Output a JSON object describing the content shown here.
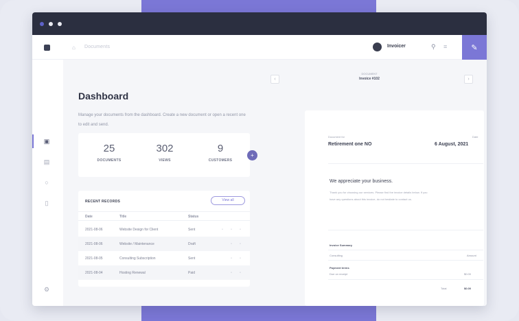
{
  "app": {
    "breadcrumb": "Documents",
    "user_name": "Invoicer",
    "colors": {
      "accent": "#7b77d6",
      "titlebar": "#2b2f40",
      "text": "#2f3345"
    }
  },
  "page": {
    "title": "Dashboard",
    "description": "Manage your documents from the dashboard. Create a new document or open a recent one to edit and send."
  },
  "stats": [
    {
      "value": "25",
      "label": "DOCUMENTS"
    },
    {
      "value": "302",
      "label": "VIEWS"
    },
    {
      "value": "9",
      "label": "CUSTOMERS"
    }
  ],
  "recent": {
    "title": "RECENT RECORDS",
    "button": "View all",
    "columns": [
      "Date",
      "Title",
      "Status"
    ],
    "rows": [
      {
        "date": "2021-08-06",
        "title": "Website Design for Client",
        "status": "Sent"
      },
      {
        "date": "2021-08-06",
        "title": "Website / Maintenance",
        "status": "Draft"
      },
      {
        "date": "2021-08-05",
        "title": "Consulting Subscription",
        "status": "Sent"
      },
      {
        "date": "2021-08-04",
        "title": "Hosting Renewal",
        "status": "Paid"
      }
    ]
  },
  "preview": {
    "label": "DOCUMENT",
    "subtitle": "Invoice #102",
    "doc": {
      "label_left": "Document for",
      "value_left": "Retirement one NO",
      "label_right": "Date",
      "value_right": "6 August, 2021",
      "heading": "We appreciate your business.",
      "paragraph": "Thank you for choosing our services. Please find the invoice details below. If you have any questions about this invoice, do not hesitate to contact us.",
      "section": "Invoice Summary",
      "item1_label": "Consulting",
      "item1_value": "Amount",
      "item2_label": "Payment terms",
      "item2_sub": "Due on receipt",
      "item2_value": "$0.00",
      "total_label": "Total",
      "total_value": "$0.00"
    }
  }
}
